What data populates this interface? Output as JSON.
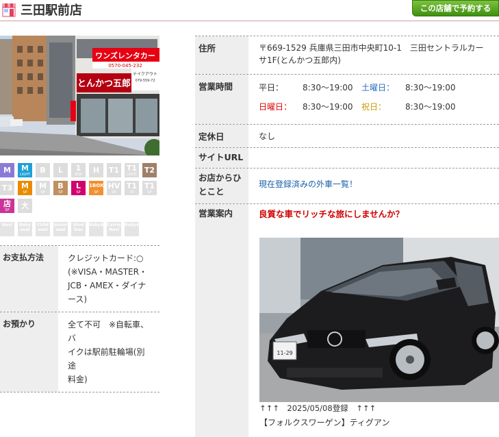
{
  "header": {
    "title": "三田駅前店",
    "reserve_button": "この店舗で予約する"
  },
  "photo": {
    "sign_main": "とんかつ五郎",
    "sign_top": "ワンズレンタカー",
    "sign_phone": "0570-045-232",
    "side_sign": "テイクアウト",
    "side_phone": "079-559-72"
  },
  "badges": {
    "row1": [
      {
        "label": "M",
        "sub": "",
        "color": "#8c7bd6"
      },
      {
        "label": "M",
        "sub": "LIGHT",
        "color": "#1ea0d6"
      },
      {
        "label": "B",
        "sub": "",
        "color": "#dddddd"
      },
      {
        "label": "L",
        "sub": "",
        "color": "#dddddd"
      },
      {
        "label": "1",
        "sub": "BOX",
        "color": "#dddddd"
      },
      {
        "label": "H",
        "sub": "",
        "color": "#dddddd"
      },
      {
        "label": "T1",
        "sub": "",
        "color": "#dddddd"
      },
      {
        "label": "T1",
        "sub": "LIGHT",
        "color": "#dddddd"
      },
      {
        "label": "T2",
        "sub": "",
        "color": "#a08068"
      }
    ],
    "row2": [
      {
        "label": "T3",
        "sub": "",
        "color": "#dddddd"
      },
      {
        "label": "M",
        "sub": "SP",
        "color": "#ea8a00"
      },
      {
        "label": "M",
        "sub": "SP",
        "color": "#dddddd"
      },
      {
        "label": "B",
        "sub": "SP",
        "color": "#c09060"
      },
      {
        "label": "L",
        "sub": "SP",
        "color": "#d0006e"
      },
      {
        "label": "1BOX",
        "sub": "SP",
        "color": "#f09030"
      },
      {
        "label": "HV",
        "sub": "SP",
        "color": "#dddddd"
      },
      {
        "label": "T1",
        "sub": "SP",
        "color": "#dddddd"
      },
      {
        "label": "T1",
        "sub": "SP",
        "color": "#dddddd"
      }
    ],
    "row3": [
      {
        "label": "店",
        "sub": "SP",
        "color": "#cc3399"
      },
      {
        "label": "大",
        "sub": "",
        "color": "#dddddd"
      }
    ],
    "options": [
      "Navi",
      "Baby seat",
      "Child seat",
      "Junior seat",
      "Stud less",
      "Baby&Chair",
      "Carrier Navi",
      "Baby&Baby"
    ]
  },
  "left_table": [
    {
      "head": "お支払方法",
      "lines": [
        "クレジットカード:○",
        "(※VISA・MASTER・",
        "JCB・AMEX・ダイナース)"
      ]
    },
    {
      "head": "お預かり",
      "lines": [
        "全て不可　※自転車、バ",
        "イクは駅前駐輪場(別途",
        "料金)"
      ]
    }
  ],
  "info": {
    "address_head": "住所",
    "address": "〒669-1529 兵庫県三田市中央町10-1　三田セントラルカーサ1F(とんかつ五郎内)",
    "hours_head": "営業時間",
    "hours": {
      "weekday_label": "平日：",
      "weekday": "8:30〜19:00",
      "sat_label": "土曜日：",
      "sat": "8:30〜19:00",
      "sun_label": "日曜日：",
      "sun": "8:30〜19:00",
      "hol_label": "祝日：",
      "hol": "8:30〜19:00"
    },
    "closed_head": "定休日",
    "closed": "なし",
    "url_head": "サイトURL",
    "url": "",
    "message_head": "お店からひとこと",
    "message_link": "現在登録済みの外車一覧！",
    "guide_head": "営業案内",
    "guide_title": "良質な車でリッチな旅にしませんか？",
    "car_plate": "11-29",
    "car_caption": "↑↑↑　2025/05/08登録　↑↑↑",
    "car_name": "【フォルクスワーゲン】ティグアン"
  },
  "colors": {
    "accent_red": "#e00000",
    "green_button": "#4a9a1a",
    "weekday_sat_blue": "#2a6ebb",
    "holiday_gold": "#c99a00"
  }
}
